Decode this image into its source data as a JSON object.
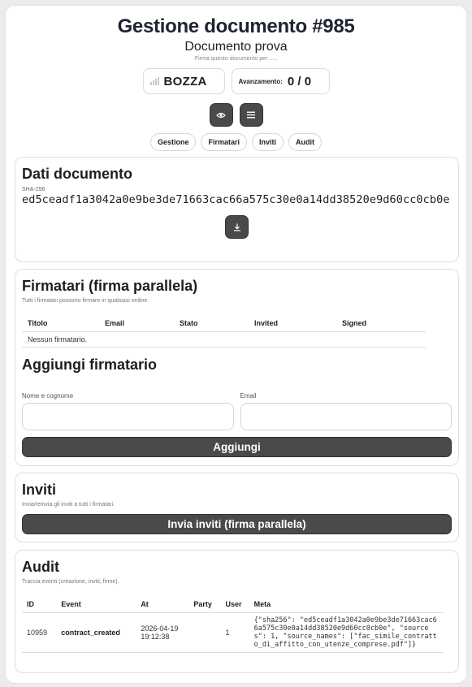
{
  "header": {
    "title": "Gestione documento #985",
    "subtitle": "Documento prova",
    "hint": "Firma questo documento per ....."
  },
  "status": {
    "label": "BOZZA",
    "icon": "signal-bars-icon"
  },
  "progress": {
    "label": "Avanzamento:",
    "value": "0 / 0"
  },
  "actions": {
    "preview_icon": "eye-icon",
    "menu_icon": "menu-icon"
  },
  "tabs": [
    "Gestione",
    "Firmatari",
    "Inviti",
    "Audit"
  ],
  "document": {
    "title": "Dati documento",
    "sha_label": "SHA-256",
    "sha_value": "ed5ceadf1a3042a0e9be3de71663cac66a575c30e0a14dd38520e9d60cc0cb0e",
    "download_icon": "download-icon"
  },
  "signers": {
    "title": "Firmatari (firma parallela)",
    "description": "Tutti i firmatari possono firmare in qualsiasi ordine.",
    "columns": [
      "Titolo",
      "Email",
      "Stato",
      "Invited",
      "Signed"
    ],
    "empty": "Nessun firmatario.",
    "add_title": "Aggiungi firmatario",
    "name_label": "Nome e cognome",
    "email_label": "Email",
    "add_button": "Aggiungi"
  },
  "invites": {
    "title": "Inviti",
    "description": "Invia/reinvia gli inviti a tutti i firmatari.",
    "button": "Invia inviti (firma parallela)"
  },
  "audit": {
    "title": "Audit",
    "description": "Traccia eventi (creazione, inviti, firme).",
    "columns": [
      "ID",
      "Event",
      "At",
      "Party",
      "User",
      "Meta"
    ],
    "rows": [
      {
        "id": "10959",
        "event": "contract_created",
        "at": "2026-04-19 19:12:38",
        "party": "",
        "user": "1",
        "meta": "{\"sha256\": \"ed5ceadf1a3042a0e9be3de71663cac66a575c30e0a14dd38520e9d60cc0cb0e\", \"sources\": 1, \"source_names\": [\"fac_simile_contratto_di_affitto_con_utenze_comprese.pdf\"]}"
      }
    ]
  },
  "colors": {
    "button": "#4a4a4a",
    "title": "#1f2433",
    "border": "#dedede"
  }
}
